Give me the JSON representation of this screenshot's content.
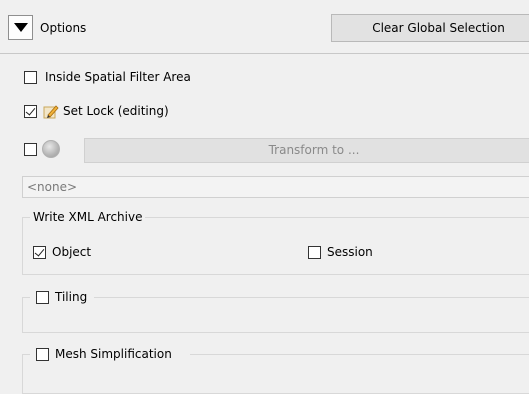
{
  "header": {
    "options_label": "Options",
    "clear_button_label": "Clear Global Selection"
  },
  "filters": {
    "inside_spatial_filter": {
      "label": "Inside Spatial Filter Area",
      "checked": false
    },
    "set_lock": {
      "label": "Set Lock (editing)",
      "checked": true
    },
    "transform": {
      "label": "Transform to ...",
      "checked": false,
      "enabled": false
    }
  },
  "transform_combo": {
    "value": "<none>"
  },
  "xml_archive": {
    "title": "Write XML Archive",
    "object": {
      "label": "Object",
      "checked": true
    },
    "session": {
      "label": "Session",
      "checked": false
    }
  },
  "tiling": {
    "label": "Tiling",
    "checked": false
  },
  "mesh_simplification": {
    "label": "Mesh Simplification",
    "checked": false
  },
  "icons": {
    "collapse": "triangle-down-icon",
    "lock": "pencil-icon",
    "transform": "globe-icon"
  }
}
